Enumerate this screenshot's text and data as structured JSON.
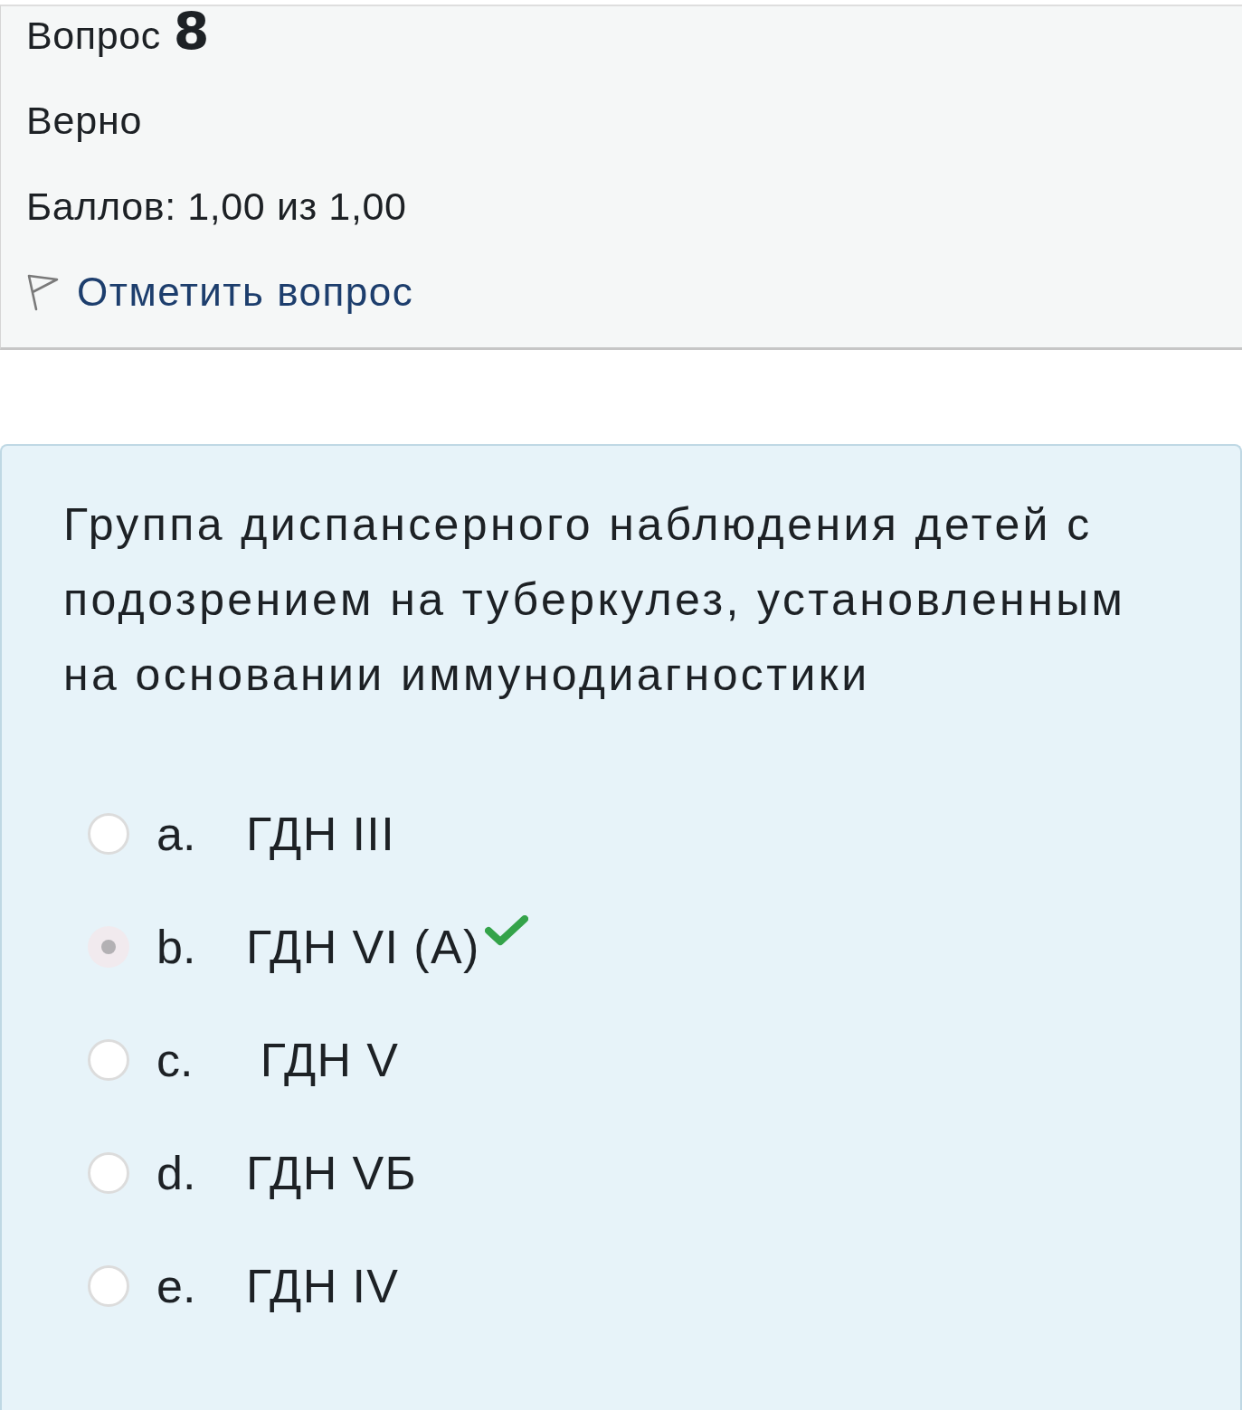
{
  "question_info": {
    "label": "Вопрос",
    "number": "8",
    "status": "Верно",
    "grade": "Баллов: 1,00 из 1,00",
    "flag_link": "Отметить вопрос"
  },
  "question": {
    "text": "Группа диспансерного наблюдения детей с подозрением на туберкулез, установленным на основании иммунодиагностики",
    "answers": [
      {
        "letter": "a.",
        "text": "ГДН III",
        "selected": false,
        "correct": false
      },
      {
        "letter": "b.",
        "text": "ГДН VI (A)",
        "selected": true,
        "correct": true
      },
      {
        "letter": "c.",
        "text": " ГДН V",
        "selected": false,
        "correct": false
      },
      {
        "letter": "d.",
        "text": "ГДН VБ",
        "selected": false,
        "correct": false
      },
      {
        "letter": "e.",
        "text": "ГДН IV",
        "selected": false,
        "correct": false
      }
    ]
  }
}
